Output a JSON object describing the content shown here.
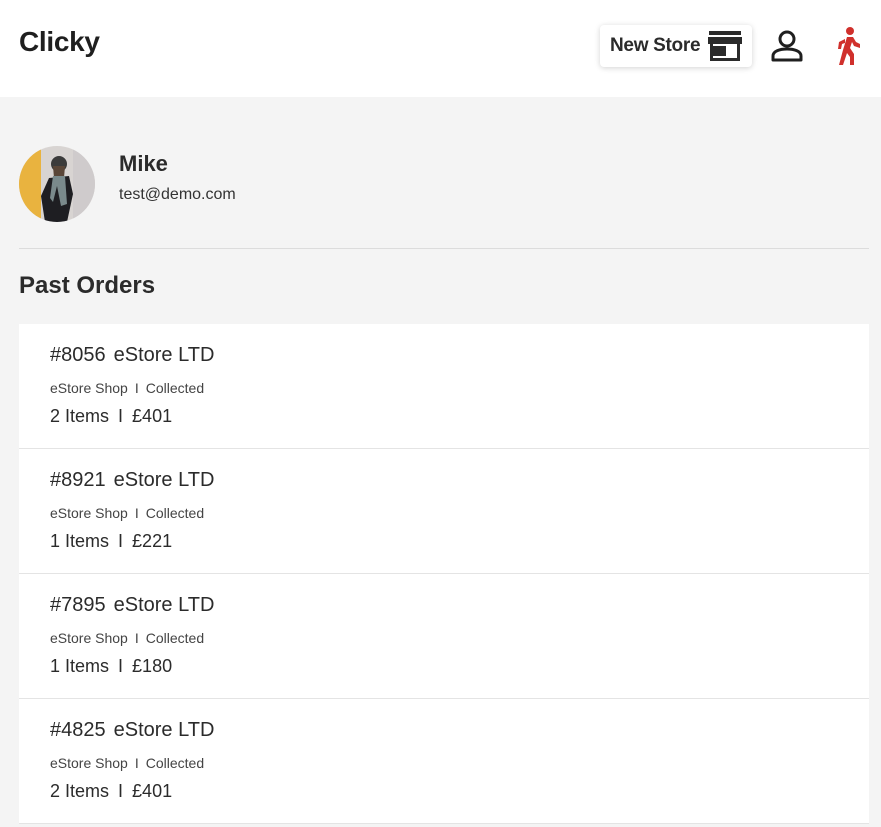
{
  "header": {
    "brand": "Clicky",
    "new_store_label": "New Store",
    "icons": {
      "store": "store-icon",
      "user": "user-icon",
      "walk": "walking-person-icon"
    },
    "accent_color": "#d0302c"
  },
  "profile": {
    "name": "Mike",
    "email": "test@demo.com"
  },
  "section_title": "Past Orders",
  "orders": [
    {
      "id": "#8056",
      "store": "eStore LTD",
      "shop": "eStore Shop",
      "sep": "I",
      "status": "Collected",
      "items": "2 Items",
      "total": "£401"
    },
    {
      "id": "#8921",
      "store": "eStore LTD",
      "shop": "eStore Shop",
      "sep": "I",
      "status": "Collected",
      "items": "1 Items",
      "total": "£221"
    },
    {
      "id": "#7895",
      "store": "eStore LTD",
      "shop": "eStore Shop",
      "sep": "I",
      "status": "Collected",
      "items": "1 Items",
      "total": "£180"
    },
    {
      "id": "#4825",
      "store": "eStore LTD",
      "shop": "eStore Shop",
      "sep": "I",
      "status": "Collected",
      "items": "2 Items",
      "total": "£401"
    }
  ]
}
